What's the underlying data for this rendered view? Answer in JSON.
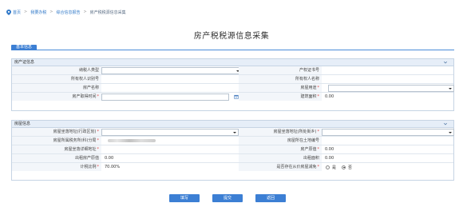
{
  "breadcrumb": {
    "items": [
      "首页",
      "我要办税",
      "综合信息报告",
      "房产税税源信息采集"
    ]
  },
  "page_title": "房产税税源信息采集",
  "tab_label": "基本信息",
  "section1": {
    "title": "房产证信息",
    "labels": {
      "taxpayer_type": "纳税人类型",
      "property_cert_no": "产权证书号",
      "owner_id_no": "所有权人识别号",
      "owner_name": "所有权人名称",
      "property_name": "房产名称",
      "building_use": "房屋用途",
      "acquired_time": "房产取得时间",
      "building_area": "建筑面积"
    },
    "values": {
      "building_area": "0.00"
    }
  },
  "section2": {
    "title": "房屋信息",
    "labels": {
      "seat_admin_area": "房屋坐落地址(行政区划)",
      "seat_street": "房屋坐落地址(所处街乡)",
      "tax_authority": "房屋所属税务所(科)分局",
      "land_parcel_no": "房屋所在土地编号",
      "detail_address": "房屋坐落详细地址",
      "original_value": "房产原值",
      "rent_original_value": "出租房产原值",
      "rent_area": "出租面积",
      "tax_ratio": "计税比例",
      "in_other_house": "是否存在从价房屋减免"
    },
    "values": {
      "original_value": "0.00",
      "rent_original_value": "0.00",
      "rent_area": "0.00",
      "tax_ratio": "70.00%"
    },
    "radio": {
      "yes": "是",
      "no": "否",
      "selected": "no"
    }
  },
  "buttons": {
    "fill": "填写",
    "submit": "提交",
    "back": "返回"
  },
  "colors": {
    "accent": "#3c7fd4",
    "header_bg": "#e6eef8",
    "required": "#e04545"
  }
}
